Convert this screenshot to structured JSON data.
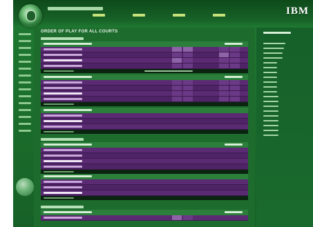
{
  "header": {
    "logo": "IBM"
  },
  "content": {
    "title": "ORDER OF PLAY FOR ALL COURTS",
    "courts": [
      {
        "matches": [
          {
            "players": [
              "",
              "",
              "",
              ""
            ],
            "result": ""
          }
        ]
      },
      {
        "matches": [
          {
            "players": [
              "",
              "",
              "",
              ""
            ],
            "result": ""
          },
          {
            "players": [
              "",
              "",
              ""
            ],
            "result": ""
          }
        ]
      },
      {
        "matches": [
          {
            "players": [
              "",
              "",
              "",
              ""
            ],
            "result": ""
          },
          {
            "players": [
              "",
              "",
              ""
            ],
            "result": ""
          }
        ]
      },
      {
        "matches": [
          {
            "players": [
              ""
            ],
            "result": ""
          }
        ]
      }
    ]
  }
}
